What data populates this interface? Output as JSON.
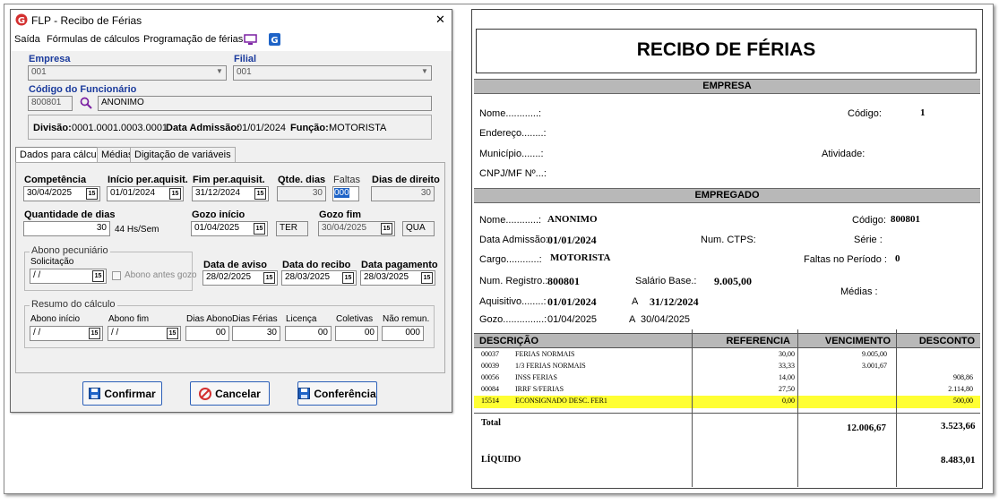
{
  "dialog": {
    "title": "FLP - Recibo de Férias",
    "close": "✕",
    "menu": [
      "Saída",
      "Fórmulas de cálculos",
      "Programação de férias"
    ],
    "empresa": {
      "label": "Empresa",
      "value": "001"
    },
    "filial": {
      "label": "Filial",
      "value": "001"
    },
    "funcionario": {
      "label": "Código do Funcionário",
      "code": "800801",
      "name": "ANONIMO"
    },
    "info": {
      "divisao_label": "Divisão:",
      "divisao": "0001.0001.0003.0001",
      "admissao_label": "Data Admissão:",
      "admissao": "01/01/2024",
      "funcao_label": "Função:",
      "funcao": "MOTORISTA"
    },
    "tabs": [
      "Dados para cálculo",
      "Médias",
      "Digitação de variáveis"
    ],
    "fields": {
      "competencia": {
        "label": "Competência",
        "value": "30/04/2025"
      },
      "inicio_aquisit": {
        "label": "Início per.aquisit.",
        "value": "01/01/2024"
      },
      "fim_aquisit": {
        "label": "Fim per.aquisit.",
        "value": "31/12/2024"
      },
      "qtde_dias": {
        "label": "Qtde. dias",
        "value": "30"
      },
      "faltas": {
        "label": "Faltas",
        "value": "000"
      },
      "dias_direito": {
        "label": "Dias de direito",
        "value": "30"
      },
      "qtd_dias": {
        "label": "Quantidade de dias",
        "value": "30",
        "suffix": "44 Hs/Sem"
      },
      "gozo_inicio": {
        "label": "Gozo início",
        "value": "01/04/2025",
        "day": "TER"
      },
      "gozo_fim": {
        "label": "Gozo fim",
        "value": "30/04/2025",
        "day": "QUA"
      },
      "abono": {
        "group": "Abono pecuniário",
        "label": "Solicitação",
        "value": " / /",
        "check": "Abono antes gozo"
      },
      "data_aviso": {
        "label": "Data de aviso",
        "value": "28/02/2025"
      },
      "data_recibo": {
        "label": "Data do recibo",
        "value": "28/03/2025"
      },
      "data_pagto": {
        "label": "Data pagamento",
        "value": "28/03/2025"
      }
    },
    "resumo": {
      "group": "Resumo do cálculo",
      "abono_inicio": {
        "label": "Abono início",
        "value": " / /"
      },
      "abono_fim": {
        "label": "Abono fim",
        "value": " / /"
      },
      "dias_abono": {
        "label": "Dias Abono",
        "value": "00"
      },
      "dias_ferias": {
        "label": "Dias Férias",
        "value": "30"
      },
      "licenca": {
        "label": "Licença",
        "value": "00"
      },
      "coletivas": {
        "label": "Coletivas",
        "value": "00"
      },
      "nao_remun": {
        "label": "Não remun.",
        "value": "000"
      }
    },
    "buttons": {
      "confirmar": "Confirmar",
      "cancelar": "Cancelar",
      "conferencia": "Conferência"
    },
    "cal_icon": "15"
  },
  "receipt": {
    "title": "RECIBO DE FÉRIAS",
    "empresa_section": "EMPRESA",
    "nome": "Nome............:",
    "endereco": "Endereço........:",
    "municipio": "Município.......:",
    "cnpj": "CNPJ/MF Nº...:",
    "codigo_label": "Código:",
    "codigo_emp": "1",
    "atividade": "Atividade:",
    "empregado_section": "EMPREGADO",
    "e_nome_label": "Nome............:",
    "e_nome": "ANONIMO",
    "e_codigo_label": "Código:",
    "e_codigo": "800801",
    "admissao_label": "Data Admissão:",
    "admissao": "01/01/2024",
    "ctps": "Num. CTPS:",
    "serie": "Série :",
    "cargo_label": "Cargo............:",
    "cargo": "MOTORISTA",
    "faltas_label": "Faltas no Período :",
    "faltas": "0",
    "registro_label": "Num. Registro.:",
    "registro": "800801",
    "salario_label": "Salário Base.:",
    "salario": "9.005,00",
    "medias": "Médias :",
    "aquisitivo_label": "Aquisitivo........:",
    "aq_ini": "01/01/2024",
    "aq_a": "A",
    "aq_fim": "31/12/2024",
    "gozo_label": "Gozo...............:",
    "gozo_ini": "01/04/2025",
    "gozo_a": "A",
    "gozo_fim": "30/04/2025",
    "cols": [
      "DESCRIÇÃO",
      "REFERENCIA",
      "VENCIMENTO",
      "DESCONTO"
    ],
    "rows": [
      {
        "cod": "00037",
        "desc": "FERIAS NORMAIS",
        "ref": "30,00",
        "venc": "9.005,00",
        "desc_v": ""
      },
      {
        "cod": "00039",
        "desc": "1/3 FERIAS NORMAIS",
        "ref": "33,33",
        "venc": "3.001,67",
        "desc_v": ""
      },
      {
        "cod": "00056",
        "desc": "INSS FERIAS",
        "ref": "14,00",
        "venc": "",
        "desc_v": "908,86"
      },
      {
        "cod": "00084",
        "desc": "IRRF S/FERIAS",
        "ref": "27,50",
        "venc": "",
        "desc_v": "2.114,80"
      },
      {
        "cod": "15514",
        "desc": "ECONSIGNADO DESC. FER1",
        "ref": "0,00",
        "venc": "",
        "desc_v": "500,00"
      }
    ],
    "total_label": "Total",
    "total_venc": "12.006,67",
    "total_desc": "3.523,66",
    "liquido_label": "LÍQUIDO",
    "liquido": "8.483,01",
    "highlight": "#ffff33"
  }
}
